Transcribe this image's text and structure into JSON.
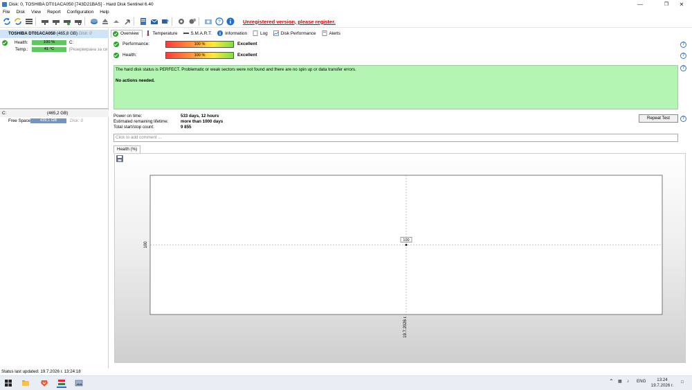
{
  "window": {
    "title": "Disk: 0, TOSHIBA DT01ACA050 [743D21BAS]  -  Hard Disk Sentinel 6.40",
    "controls": [
      "minimize-icon",
      "maximize-icon",
      "close-icon"
    ]
  },
  "menu": [
    "File",
    "Disk",
    "View",
    "Report",
    "Configuration",
    "Help"
  ],
  "toolbar": {
    "unregistered": "Unregistered version, please register."
  },
  "left": {
    "disk_name": "TOSHIBA DT01ACA050",
    "disk_size": "(465,8 GB)",
    "disk_index": "Disk: 0",
    "health_label": "Health:",
    "health_value": "100 %",
    "health_percent": 100,
    "health_drive": "C:",
    "temp_label": "Temp.:",
    "temp_value": "41 °C",
    "temp_note": "[Резервирана за си",
    "volume_letter": "C:",
    "volume_size": "(465,2 GB)",
    "free_label": "Free Space",
    "free_value": "439,1 GB",
    "free_disk": "Disk: 0"
  },
  "tabs": [
    {
      "label": "Overview",
      "icon": "check-icon"
    },
    {
      "label": "Temperature",
      "icon": "thermometer-icon"
    },
    {
      "label": "S.M.A.R.T.",
      "icon": "smart-icon"
    },
    {
      "label": "Information",
      "icon": "info-icon"
    },
    {
      "label": "Log",
      "icon": "log-icon"
    },
    {
      "label": "Disk Performance",
      "icon": "performance-icon"
    },
    {
      "label": "Alerts",
      "icon": "alerts-icon"
    }
  ],
  "overview": {
    "performance_label": "Performance:",
    "performance_value": "100 %",
    "performance_percent": 100,
    "performance_status": "Excellent",
    "health_label": "Health:",
    "health_value": "100 %",
    "health_percent": 100,
    "health_status": "Excellent",
    "status_text": "The hard disk status is PERFECT. Problematic or weak sectors were not found and there are no spin up or data transfer errors.",
    "actions_text": "No actions needed.",
    "power_on_label": "Power on time:",
    "power_on_value": "533 days, 12 hours",
    "lifetime_label": "Estimated remaining lifetime:",
    "lifetime_value": "more than 1000 days",
    "startstop_label": "Total start/stop count:",
    "startstop_value": "9 855",
    "repeat_button": "Repeat Test",
    "comment_placeholder": "Click to add comment ...",
    "chart_tab": "Health (%)"
  },
  "chart_data": {
    "type": "line",
    "title": "",
    "xlabel": "",
    "ylabel": "",
    "x": [
      "19.7.2026 г."
    ],
    "series": [
      {
        "values": [
          100
        ]
      }
    ],
    "y_tick_labels": [
      "100"
    ],
    "data_labels": [
      "100"
    ],
    "grid": true
  },
  "status": {
    "text": "Status last updated: 19.7.2026 г. 13:24:18"
  },
  "taskbar": {
    "lang": "ENG",
    "time": "13:24",
    "date": "19.7.2026 г."
  },
  "colors": {
    "selected_row": "#cfe4f7",
    "status_green": "#b4f5b4",
    "unregistered_red": "#d00000",
    "bar_green": "#63c463"
  }
}
